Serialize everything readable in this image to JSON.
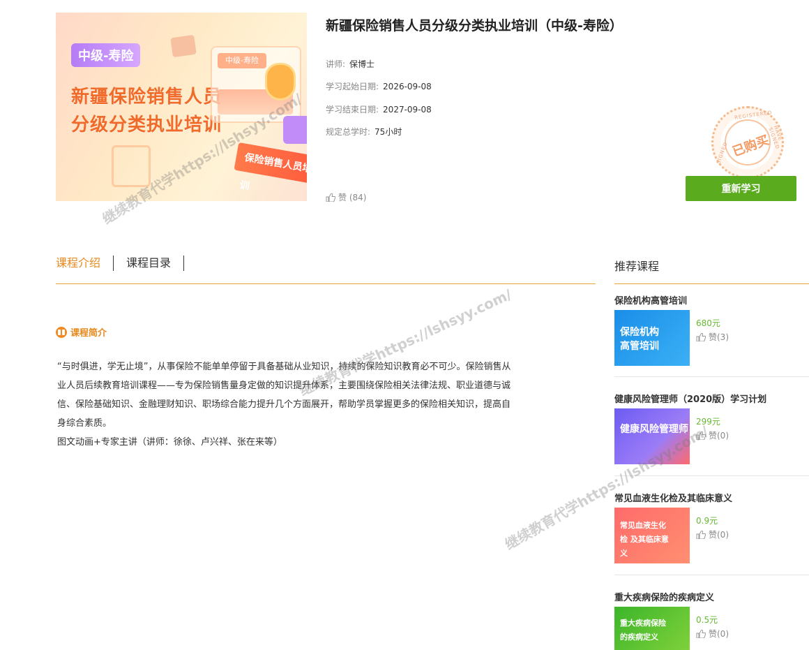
{
  "course": {
    "cover_tag": "中级-寿险",
    "cover_title_line1": "新疆保险销售人员",
    "cover_title_line2": "分级分类执业培训",
    "cover_card_label": "中级-寿险",
    "cover_banner": "保险销售人员培训",
    "title": "新疆保险销售人员分级分类执业培训（中级-寿险）",
    "lecturer_label": "讲师:",
    "lecturer": "保博士",
    "start_label": "学习起始日期:",
    "start_date": "2026-09-08",
    "end_label": "学习结束日期:",
    "end_date": "2027-09-08",
    "hours_label": "规定总学时:",
    "hours": "75小时",
    "likes_label": "赞",
    "likes_count": "(84)",
    "stamp_text": "已购买",
    "stamp_ring_top": "REGISTERED",
    "stamp_ring_right": "HAVE SIGNED",
    "stamp_ring_left": "SIGNED",
    "restudy_button": "重新学习"
  },
  "tabs": [
    {
      "label": "课程介绍",
      "active": true
    },
    {
      "label": "课程目录",
      "active": false
    }
  ],
  "intro": {
    "section_title": "课程简介",
    "paragraph": "“与时俱进，学无止境”，从事保险不能单单停留于具备基础从业知识，持续的保险知识教育必不可少。保险销售从业人员后续教育培训课程——专为保险销售量身定做的知识提升体系，主要围绕保险相关法律法规、职业道德与诚信、保险基础知识、金融理财知识、职场综合能力提升几个方面展开，帮助学员掌握更多的保险相关知识，提高自身综合素质。",
    "lecturers": "图文动画+专家主讲（讲师：徐徐、卢兴祥、张在来等）"
  },
  "recommend": {
    "title": "推荐课程",
    "items": [
      {
        "name": "保险机构高管培训",
        "thumb_text": "保险机构 高管培训",
        "price": "680元",
        "likes": "赞(3)"
      },
      {
        "name": "健康风险管理师（2020版）学习计划",
        "thumb_text": "健康风险管理师",
        "price": "299元",
        "likes": "赞(0)"
      },
      {
        "name": "常见血液生化检及其临床意义",
        "thumb_text": "常见血液生化检 及其临床意义",
        "price": "0.9元",
        "likes": "赞(0)"
      },
      {
        "name": "重大疾病保险的疾病定义",
        "thumb_text": "重大疾病保险 的疾病定义",
        "price": "0.5元",
        "likes": "赞(0)"
      }
    ]
  },
  "watermark": "继续教育代学https://lshsyy.com/",
  "colors": {
    "accent_orange": "#e8891c",
    "button_green": "#5aac1e",
    "price_green": "#66b832"
  }
}
